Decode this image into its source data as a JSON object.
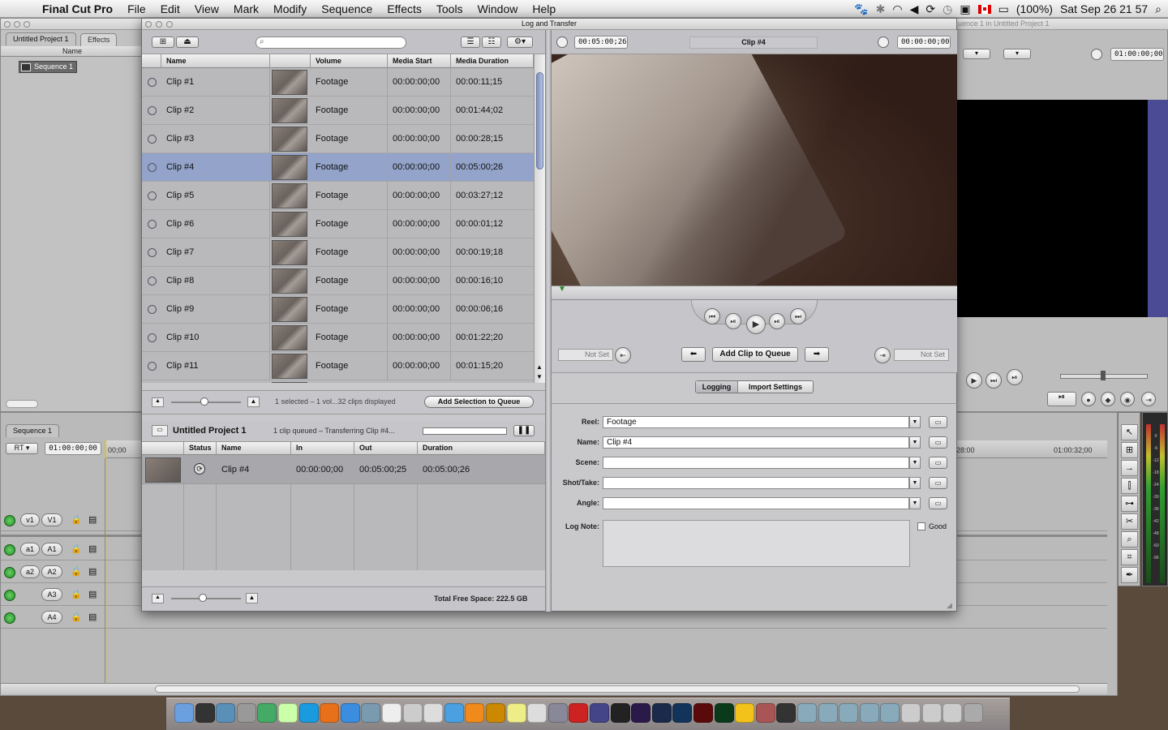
{
  "menubar": {
    "app": "Final Cut Pro",
    "items": [
      "File",
      "Edit",
      "View",
      "Mark",
      "Modify",
      "Sequence",
      "Effects",
      "Tools",
      "Window",
      "Help"
    ],
    "battery": "(100%)",
    "clock": "Sat Sep 26  21 57"
  },
  "browser_panel": {
    "tabs": [
      "Untitled Project 1",
      "Effects"
    ],
    "col_name": "Name",
    "item": "Sequence 1"
  },
  "canvas_panel": {
    "title_partial": "uence 1 in Untitled Project 1",
    "timecode": "01:00:00;00"
  },
  "timeline": {
    "tab": "Sequence 1",
    "rt": "RT",
    "timecode": "01:00:00;00",
    "ruler_start": "00;00",
    "ruler_mid": "28:00",
    "ruler_end": "01:00:32;00",
    "tracks": [
      {
        "src": "v1",
        "dst": "V1"
      },
      {
        "src": "a1",
        "dst": "A1"
      },
      {
        "src": "a2",
        "dst": "A2"
      },
      {
        "src": "",
        "dst": "A3"
      },
      {
        "src": "",
        "dst": "A4"
      }
    ]
  },
  "meters": {
    "labels": [
      "0",
      "-6",
      "-12",
      "-18",
      "-24",
      "-30",
      "-36",
      "-42",
      "-48",
      "-60",
      "-96"
    ]
  },
  "log_transfer": {
    "title": "Log and Transfer",
    "columns": [
      "Name",
      "Volume",
      "Media Start",
      "Media Duration"
    ],
    "clips": [
      {
        "name": "Clip #1",
        "volume": "Footage",
        "start": "00:00:00;00",
        "duration": "00:00:11;15"
      },
      {
        "name": "Clip #2",
        "volume": "Footage",
        "start": "00:00:00;00",
        "duration": "00:01:44;02"
      },
      {
        "name": "Clip #3",
        "volume": "Footage",
        "start": "00:00:00;00",
        "duration": "00:00:28;15"
      },
      {
        "name": "Clip #4",
        "volume": "Footage",
        "start": "00:00:00;00",
        "duration": "00:05:00;26"
      },
      {
        "name": "Clip #5",
        "volume": "Footage",
        "start": "00:00:00;00",
        "duration": "00:03:27;12"
      },
      {
        "name": "Clip #6",
        "volume": "Footage",
        "start": "00:00:00;00",
        "duration": "00:00:01;12"
      },
      {
        "name": "Clip #7",
        "volume": "Footage",
        "start": "00:00:00;00",
        "duration": "00:00:19;18"
      },
      {
        "name": "Clip #8",
        "volume": "Footage",
        "start": "00:00:00;00",
        "duration": "00:00:16;10"
      },
      {
        "name": "Clip #9",
        "volume": "Footage",
        "start": "00:00:00;00",
        "duration": "00:00:06;16"
      },
      {
        "name": "Clip #10",
        "volume": "Footage",
        "start": "00:00:00;00",
        "duration": "00:01:22;20"
      },
      {
        "name": "Clip #11",
        "volume": "Footage",
        "start": "00:00:00;00",
        "duration": "00:01:15;20"
      }
    ],
    "selected_clip": "Clip #4",
    "status_text": "1 selected – 1 vol...32 clips displayed",
    "add_selection_btn": "Add Selection to Queue",
    "queue_title": "Untitled Project 1",
    "queue_status": "1 clip queued – Transferring Clip #4...",
    "queue_columns": [
      "Status",
      "Name",
      "In",
      "Out",
      "Duration"
    ],
    "queue_rows": [
      {
        "name": "Clip #4",
        "in": "00:00:00;00",
        "out": "00:05:00;25",
        "duration": "00:05:00;26"
      }
    ],
    "free_space": "Total Free Space: 222.5 GB",
    "viewer_duration": "00:05:00;26",
    "viewer_clip": "Clip #4",
    "viewer_timecode": "00:00:00;00",
    "in_point": "Not Set",
    "out_point": "Not Set",
    "add_clip_btn": "Add Clip to Queue",
    "tabs": [
      "Logging",
      "Import Settings"
    ],
    "fields": {
      "reel_label": "Reel:",
      "reel": "Footage",
      "name_label": "Name:",
      "name": "Clip #4",
      "scene_label": "Scene:",
      "scene": "",
      "shot_label": "Shot/Take:",
      "shot": "",
      "angle_label": "Angle:",
      "angle": "",
      "lognote_label": "Log Note:",
      "lognote": "",
      "good_label": "Good"
    }
  },
  "colors": {
    "selection": "#93a3c9",
    "accent": "#7f8fb8"
  }
}
